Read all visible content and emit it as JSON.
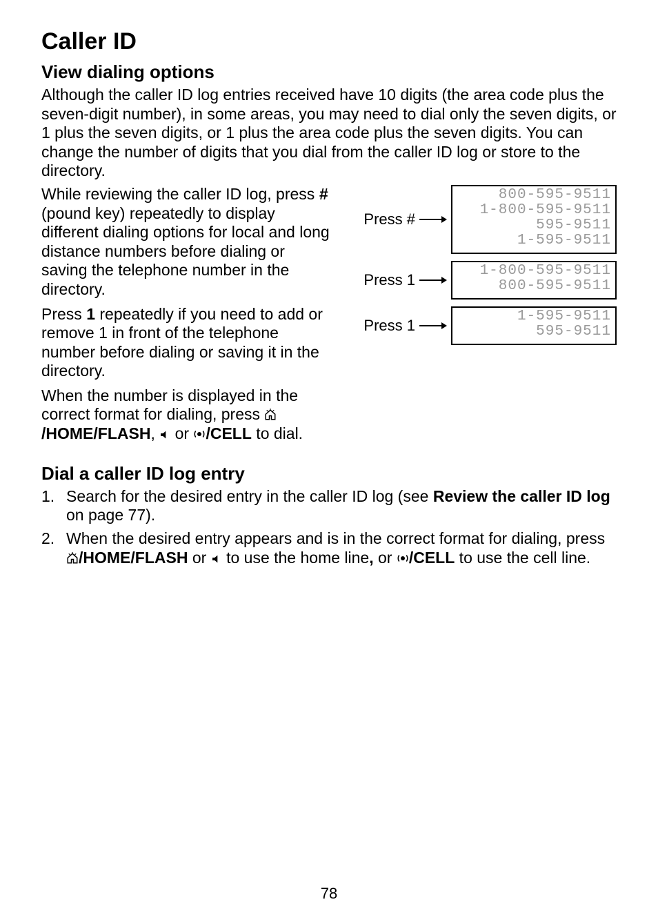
{
  "title": "Caller ID",
  "view_dialing": {
    "heading": "View dialing options",
    "intro": "Although the caller ID log entries received have 10 digits (the area code plus the seven-digit number), in some areas, you may need to dial only the seven digits, or 1 plus the seven digits, or 1 plus the area code plus the seven digits. You can change the number of digits that you dial from the caller ID log or store to the directory.",
    "para_pound_a": "While reviewing the caller ID log, press ",
    "para_pound_b": " (pound key) repeatedly to display different dialing options for local and long distance numbers before dialing or saving the telephone number in the directory.",
    "pound_key": "#",
    "para_one_a": "Press ",
    "para_one_b": " repeatedly if you need to add or remove 1 in front of the telephone number before dialing or saving it in the directory.",
    "one_key": "1",
    "para_dial_a": "When the number is displayed in the correct format for dialing, press ",
    "home_label": "/HOME/",
    "flash_label": "FLASH",
    "comma_space": ", ",
    "or_text": "or ",
    "cell_label": "/CELL",
    "para_dial_b": " to dial.",
    "press_pound_label": "Press #",
    "press_one_label": "Press 1",
    "blocks": {
      "pound": [
        "800-595-9511",
        "1-800-595-9511",
        "595-9511",
        "1-595-9511"
      ],
      "one_a": [
        "1-800-595-9511",
        "800-595-9511"
      ],
      "one_b": [
        "1-595-9511",
        "595-9511"
      ]
    }
  },
  "dial_entry": {
    "heading": "Dial a caller ID log entry",
    "step1_a": "Search for the desired entry in the caller ID log (see ",
    "step1_bold": "Review the caller ID log",
    "step1_b": " on page 77).",
    "step2_a": "When the desired entry appears and is in the correct format for dialing, press ",
    "home_label": "/HOME/",
    "flash_label": "FLASH",
    "or_text_1": " or ",
    "step2_b": " to use the home line",
    "comma_bold": ",",
    "or_text_2": " or ",
    "cell_label": "/CELL",
    "step2_c": " to use the cell line."
  },
  "page_number": "78"
}
